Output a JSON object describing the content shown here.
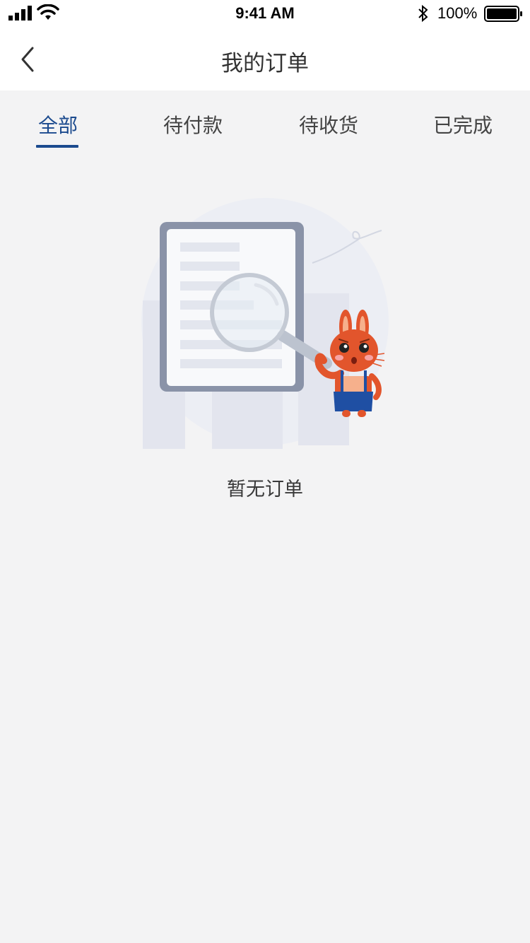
{
  "status_bar": {
    "time": "9:41 AM",
    "battery_percent": "100%",
    "icons": [
      "signal-icon",
      "wifi-icon",
      "bluetooth-icon",
      "battery-icon"
    ]
  },
  "nav": {
    "title": "我的订单",
    "back_icon": "chevron-left-icon"
  },
  "tabs": [
    {
      "label": "全部",
      "active": true
    },
    {
      "label": "待付款",
      "active": false
    },
    {
      "label": "待收货",
      "active": false
    },
    {
      "label": "已完成",
      "active": false
    }
  ],
  "empty_state": {
    "message": "暂无订单",
    "illustration": "document-magnifier-rabbit"
  },
  "colors": {
    "accent": "#1b4a8e",
    "background": "#f3f3f4",
    "rabbit": "#e2552c",
    "overalls": "#1f4fa3"
  }
}
